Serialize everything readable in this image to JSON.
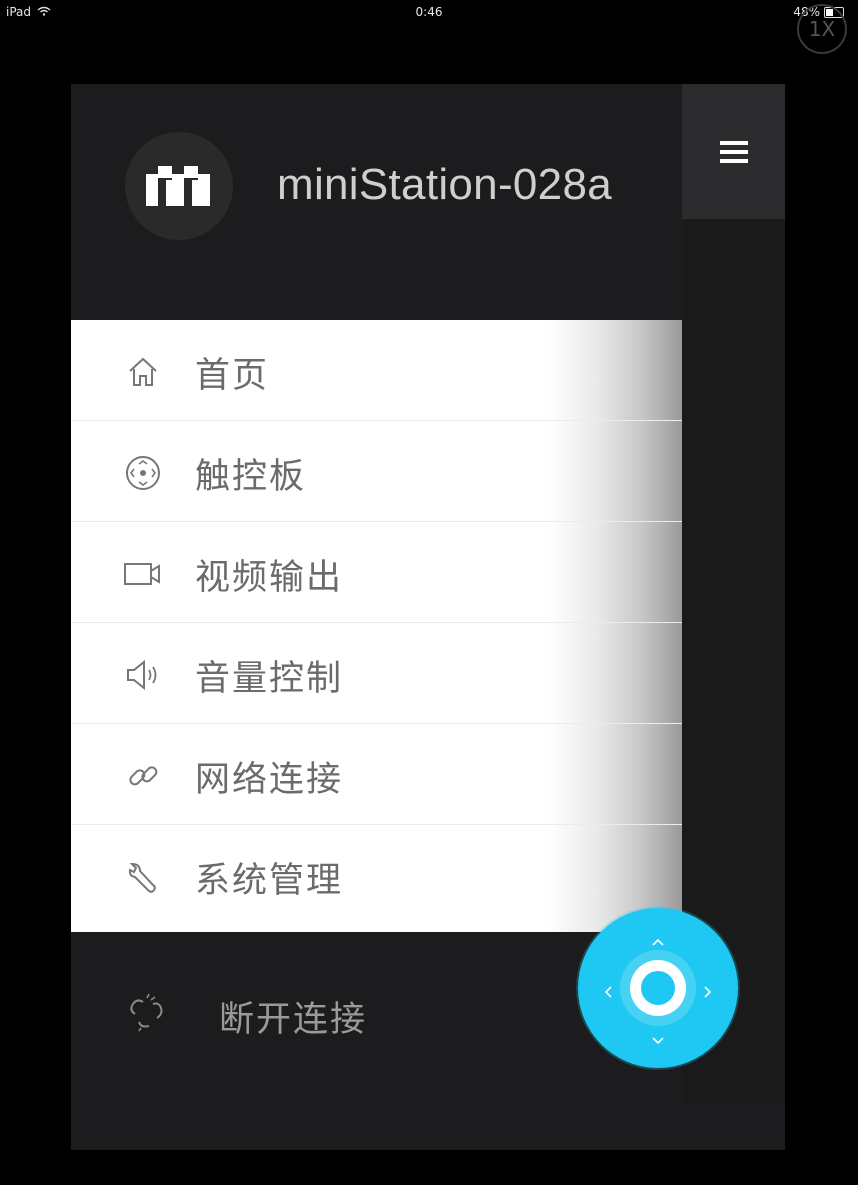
{
  "status_bar": {
    "device": "iPad",
    "time": "0:46",
    "battery": "48%",
    "wifi_icon": "wifi-icon",
    "battery_icon": "battery-icon"
  },
  "zoom_badge": "1X",
  "header": {
    "device_name": "miniStation-028a",
    "logo_icon": "ministation-logo-icon"
  },
  "menu_button_icon": "hamburger-menu-icon",
  "menu": {
    "items": [
      {
        "label": "首页",
        "icon": "home-icon"
      },
      {
        "label": "触控板",
        "icon": "touchpad-icon"
      },
      {
        "label": "视频输出",
        "icon": "video-camera-icon"
      },
      {
        "label": "音量控制",
        "icon": "speaker-icon"
      },
      {
        "label": "网络连接",
        "icon": "link-icon"
      },
      {
        "label": "系统管理",
        "icon": "wrench-icon"
      }
    ]
  },
  "disconnect": {
    "label": "断开连接",
    "icon": "broken-link-icon"
  },
  "dpad": {
    "icons": [
      "arrow-up-icon",
      "arrow-down-icon",
      "arrow-left-icon",
      "arrow-right-icon"
    ]
  },
  "colors": {
    "accent": "#1fc8f2",
    "panel_bg": "#1c1c1e",
    "menu_text": "#6b6b6b"
  }
}
